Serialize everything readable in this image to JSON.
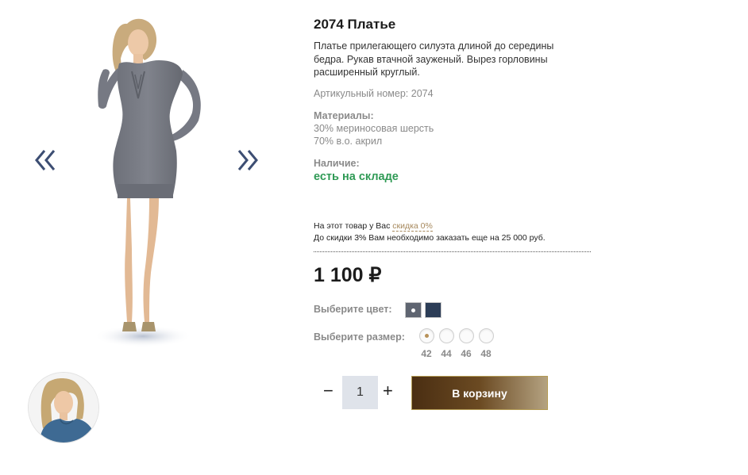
{
  "gallery": {
    "prev_icon": "double-chevron-left-icon",
    "next_icon": "double-chevron-right-icon",
    "arrow_color": "#3d4e73"
  },
  "product": {
    "title": "2074 Платье",
    "description": "Платье прилегающего силуэта длиной до середины бедра. Рукав втачной зауженый. Вырез горловины расширенный круглый.",
    "article": "Артикульный номер: 2074",
    "materials_label": "Материалы:",
    "materials": [
      "30% мериносовая шерсть",
      "70% в.о. акрил"
    ],
    "availability_label": "Наличие:",
    "availability_value": "есть на складе",
    "availability_color": "#2f9a55"
  },
  "discount": {
    "line1_prefix": "На этот товар у Вас ",
    "line1_link": "скидка 0%",
    "line2": "До скидки 3% Вам необходимо заказать еще на 25 000 руб."
  },
  "price": "1 100 ₽",
  "options": {
    "color_label": "Выберите цвет:",
    "colors": [
      "#5f6571",
      "#2c3d57"
    ],
    "selected_color_index": 0,
    "size_label": "Выберите размер:",
    "sizes": [
      "42",
      "44",
      "46",
      "48"
    ],
    "selected_size": "42"
  },
  "quantity": {
    "minus": "−",
    "value": "1",
    "plus": "+"
  },
  "cart_button": "В корзину",
  "accent_color": "#b8925a"
}
